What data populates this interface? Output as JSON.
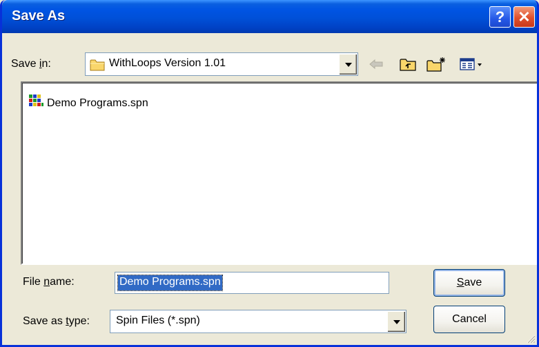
{
  "window": {
    "title": "Save As",
    "help_label": "?",
    "close_label": "✕"
  },
  "save_in": {
    "label_prefix": "Save ",
    "label_accel": "i",
    "label_suffix": "n:",
    "value": "WithLoops Version 1.01"
  },
  "toolbar": {
    "icons": [
      "back-arrow-icon",
      "up-one-level-icon",
      "create-new-folder-icon",
      "view-menu-icon"
    ]
  },
  "files": [
    {
      "name": "Demo Programs.spn",
      "icon": "spin-file-icon"
    }
  ],
  "file_name": {
    "label_prefix": "File ",
    "label_accel": "n",
    "label_suffix": "ame:",
    "value": "Demo Programs.spn"
  },
  "save_as_type": {
    "label_prefix": "Save as ",
    "label_accel": "t",
    "label_suffix": "ype:",
    "value": "Spin Files (*.spn)"
  },
  "buttons": {
    "save_accel": "S",
    "save_rest": "ave",
    "cancel": "Cancel"
  },
  "colors": {
    "titlebar": "#0054e3",
    "selection": "#316ac5",
    "face": "#ece9d8"
  }
}
